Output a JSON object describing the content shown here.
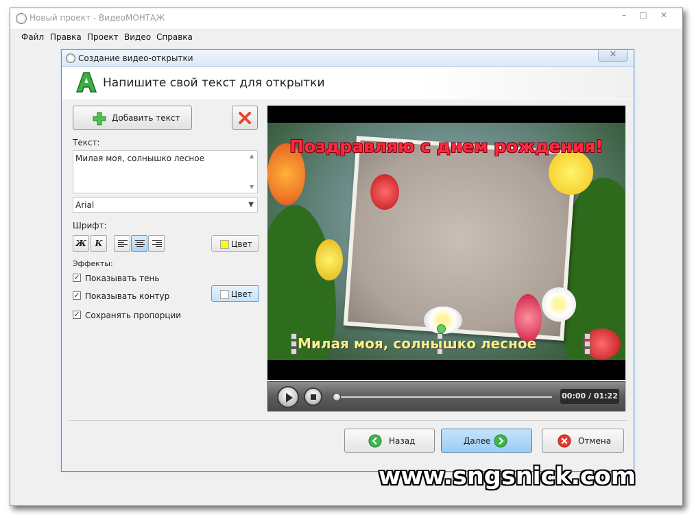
{
  "app": {
    "title": "Новый проект - ВидеоМОНТАЖ",
    "window_controls": {
      "minimize": "–",
      "maximize": "□",
      "close": "✕"
    },
    "menu": [
      "Файл",
      "Правка",
      "Проект",
      "Видео",
      "Справка"
    ]
  },
  "dialog": {
    "title": "Создание видео-открытки",
    "close": "✕",
    "header_title": "Напишите свой текст для открытки",
    "header_icon": "letter-a-icon"
  },
  "left_panel": {
    "add_text_label": "Добавить текст",
    "add_icon": "plus-icon",
    "delete_icon": "delete-x-icon",
    "text_label": "Текст:",
    "text_value": "Милая моя, солнышко лесное",
    "font_value": "Arial",
    "font_label": "Шрифт:",
    "bold": "Ж",
    "italic": "К",
    "align_active": "center",
    "color_label": "Цвет",
    "text_color": "#ffff00",
    "effects_label": "Эффекты:",
    "effects": [
      {
        "label": "Показывать тень",
        "checked": true
      },
      {
        "label": "Показывать контур",
        "checked": true
      },
      {
        "label": "Сохранять пропорции",
        "checked": true
      }
    ],
    "outline_color": "#ffffff"
  },
  "preview": {
    "greeting": "Поздравляю с днем рождения!",
    "overlay_text": "Милая моя, солнышко лесное",
    "time": "00:00 / 01:22",
    "progress": 0
  },
  "footer": {
    "back": "Назад",
    "next": "Далее",
    "cancel": "Отмена"
  },
  "watermark": "www.sngsnick.com",
  "colors": {
    "accent": "#9ccdf6",
    "greeting_text": "#ff2a3f",
    "overlay_text": "#f7f08a"
  }
}
